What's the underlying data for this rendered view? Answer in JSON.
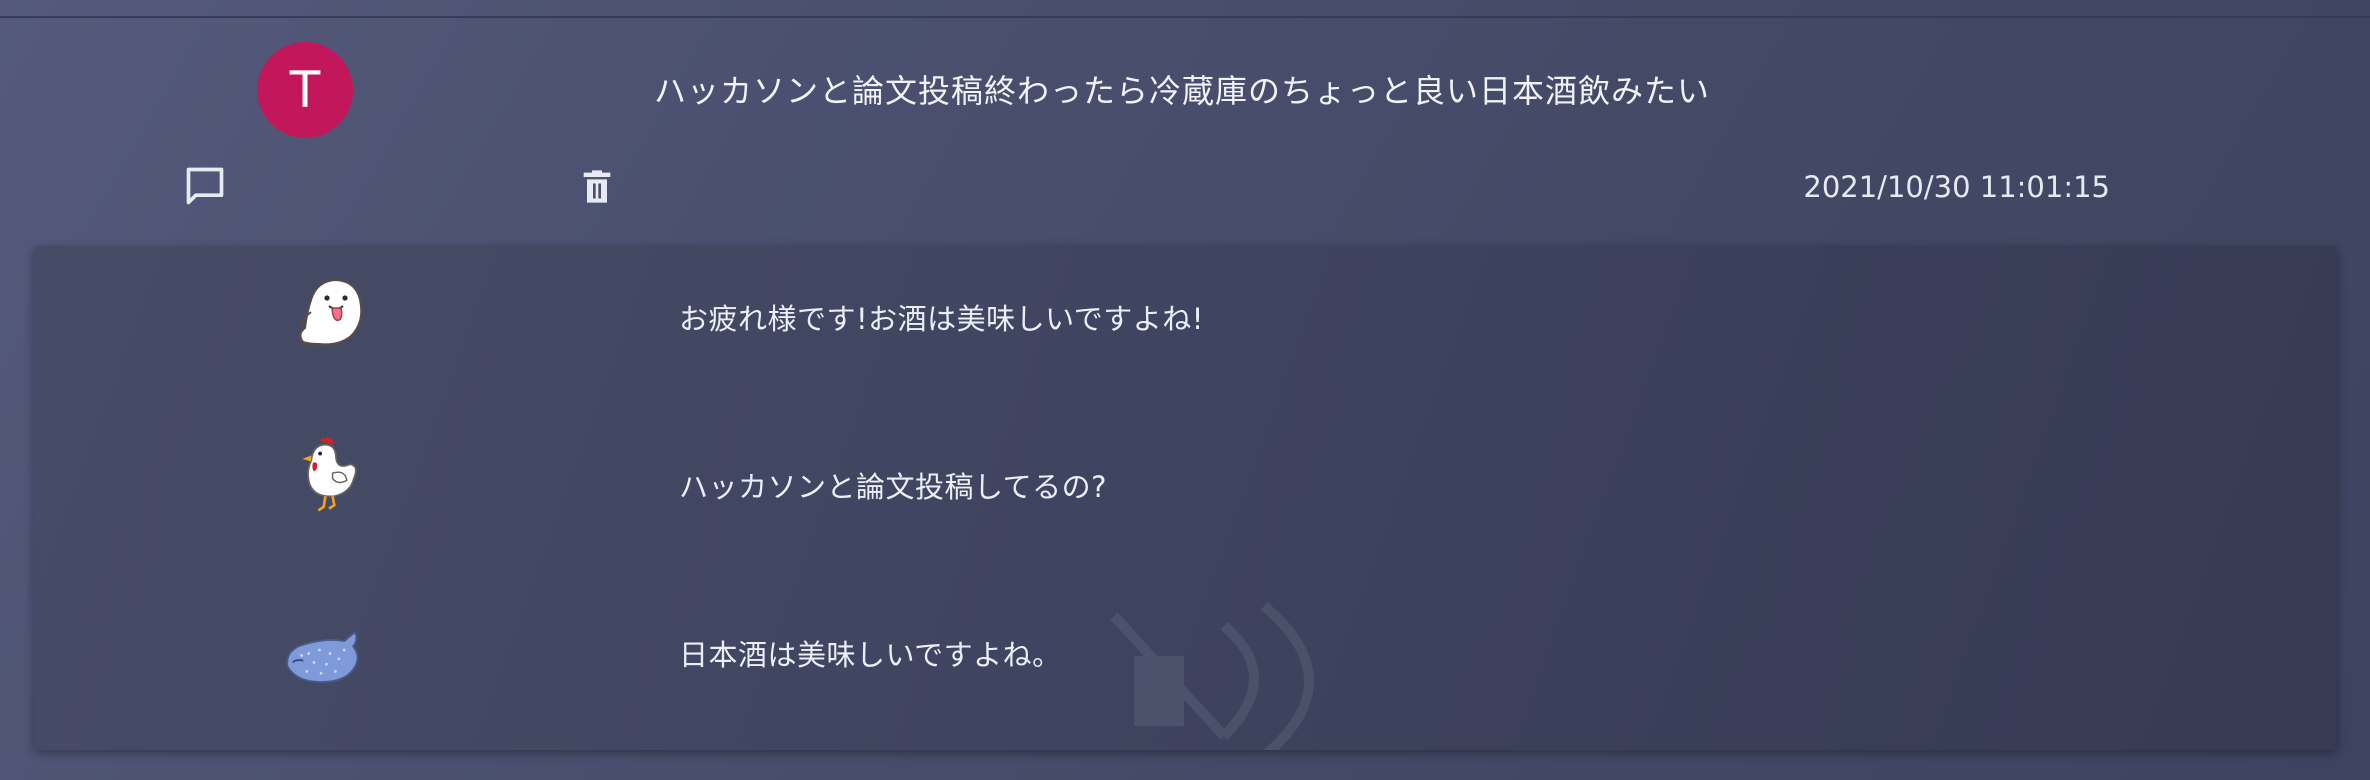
{
  "post": {
    "avatar_initial": "T",
    "avatar_color": "#c2185b",
    "text": "ハッカソンと論文投稿終わったら冷蔵庫のちょっと良い日本酒飲みたい",
    "timestamp": "2021/10/30 11:01:15",
    "actions": [
      {
        "name": "comment",
        "icon": "comment-icon"
      },
      {
        "name": "delete",
        "icon": "trash-icon"
      }
    ]
  },
  "replies": [
    {
      "avatar": "ghost-avatar-icon",
      "text": "お疲れ様です!お酒は美味しいですよね!"
    },
    {
      "avatar": "chicken-avatar-icon",
      "text": "ハッカソンと論文投稿してるの?"
    },
    {
      "avatar": "blue-fish-avatar-icon",
      "text": "日本酒は美味しいですよね。"
    }
  ]
}
